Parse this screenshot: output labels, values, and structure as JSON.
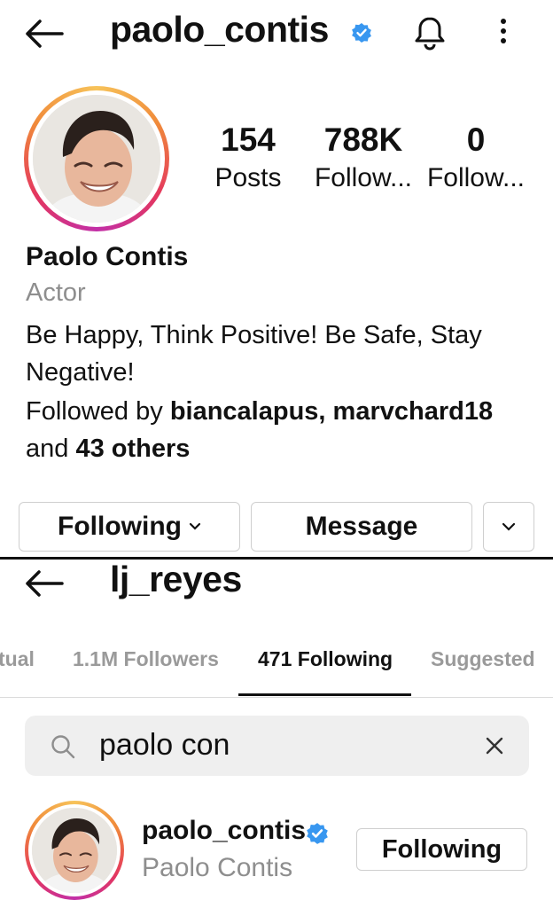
{
  "profile": {
    "handle": "paolo_contis",
    "stats": [
      {
        "value": "154",
        "label": "Posts"
      },
      {
        "value": "788K",
        "label": "Follow..."
      },
      {
        "value": "0",
        "label": "Follow..."
      }
    ],
    "full_name": "Paolo Contis",
    "category": "Actor",
    "bio": "Be Happy, Think Positive! Be Safe, Stay Negative!",
    "followed_by": {
      "prefix": "Followed by",
      "names": "biancalapus, marvchard18",
      "conjunction": "and",
      "others": "43 others"
    },
    "buttons": {
      "following": "Following",
      "message": "Message"
    }
  },
  "following_screen": {
    "handle": "lj_reyes",
    "tabs": [
      {
        "label": "tual"
      },
      {
        "label": "1.1M Followers"
      },
      {
        "label": "471 Following",
        "active": true
      },
      {
        "label": "Suggested"
      }
    ],
    "search_value": "paolo con",
    "result": {
      "handle": "paolo_contis",
      "name": "Paolo Contis",
      "button": "Following"
    }
  },
  "colors": {
    "verified": "#3897f0",
    "secondary_text": "#8e8e8e",
    "story_ring": [
      "#f7c35a",
      "#f08a3a",
      "#e4375e",
      "#c22fa7"
    ]
  },
  "icons": [
    "back-arrow-icon",
    "verified-badge-icon",
    "bell-icon",
    "more-vertical-icon",
    "chevron-down-icon",
    "search-icon",
    "close-icon"
  ]
}
